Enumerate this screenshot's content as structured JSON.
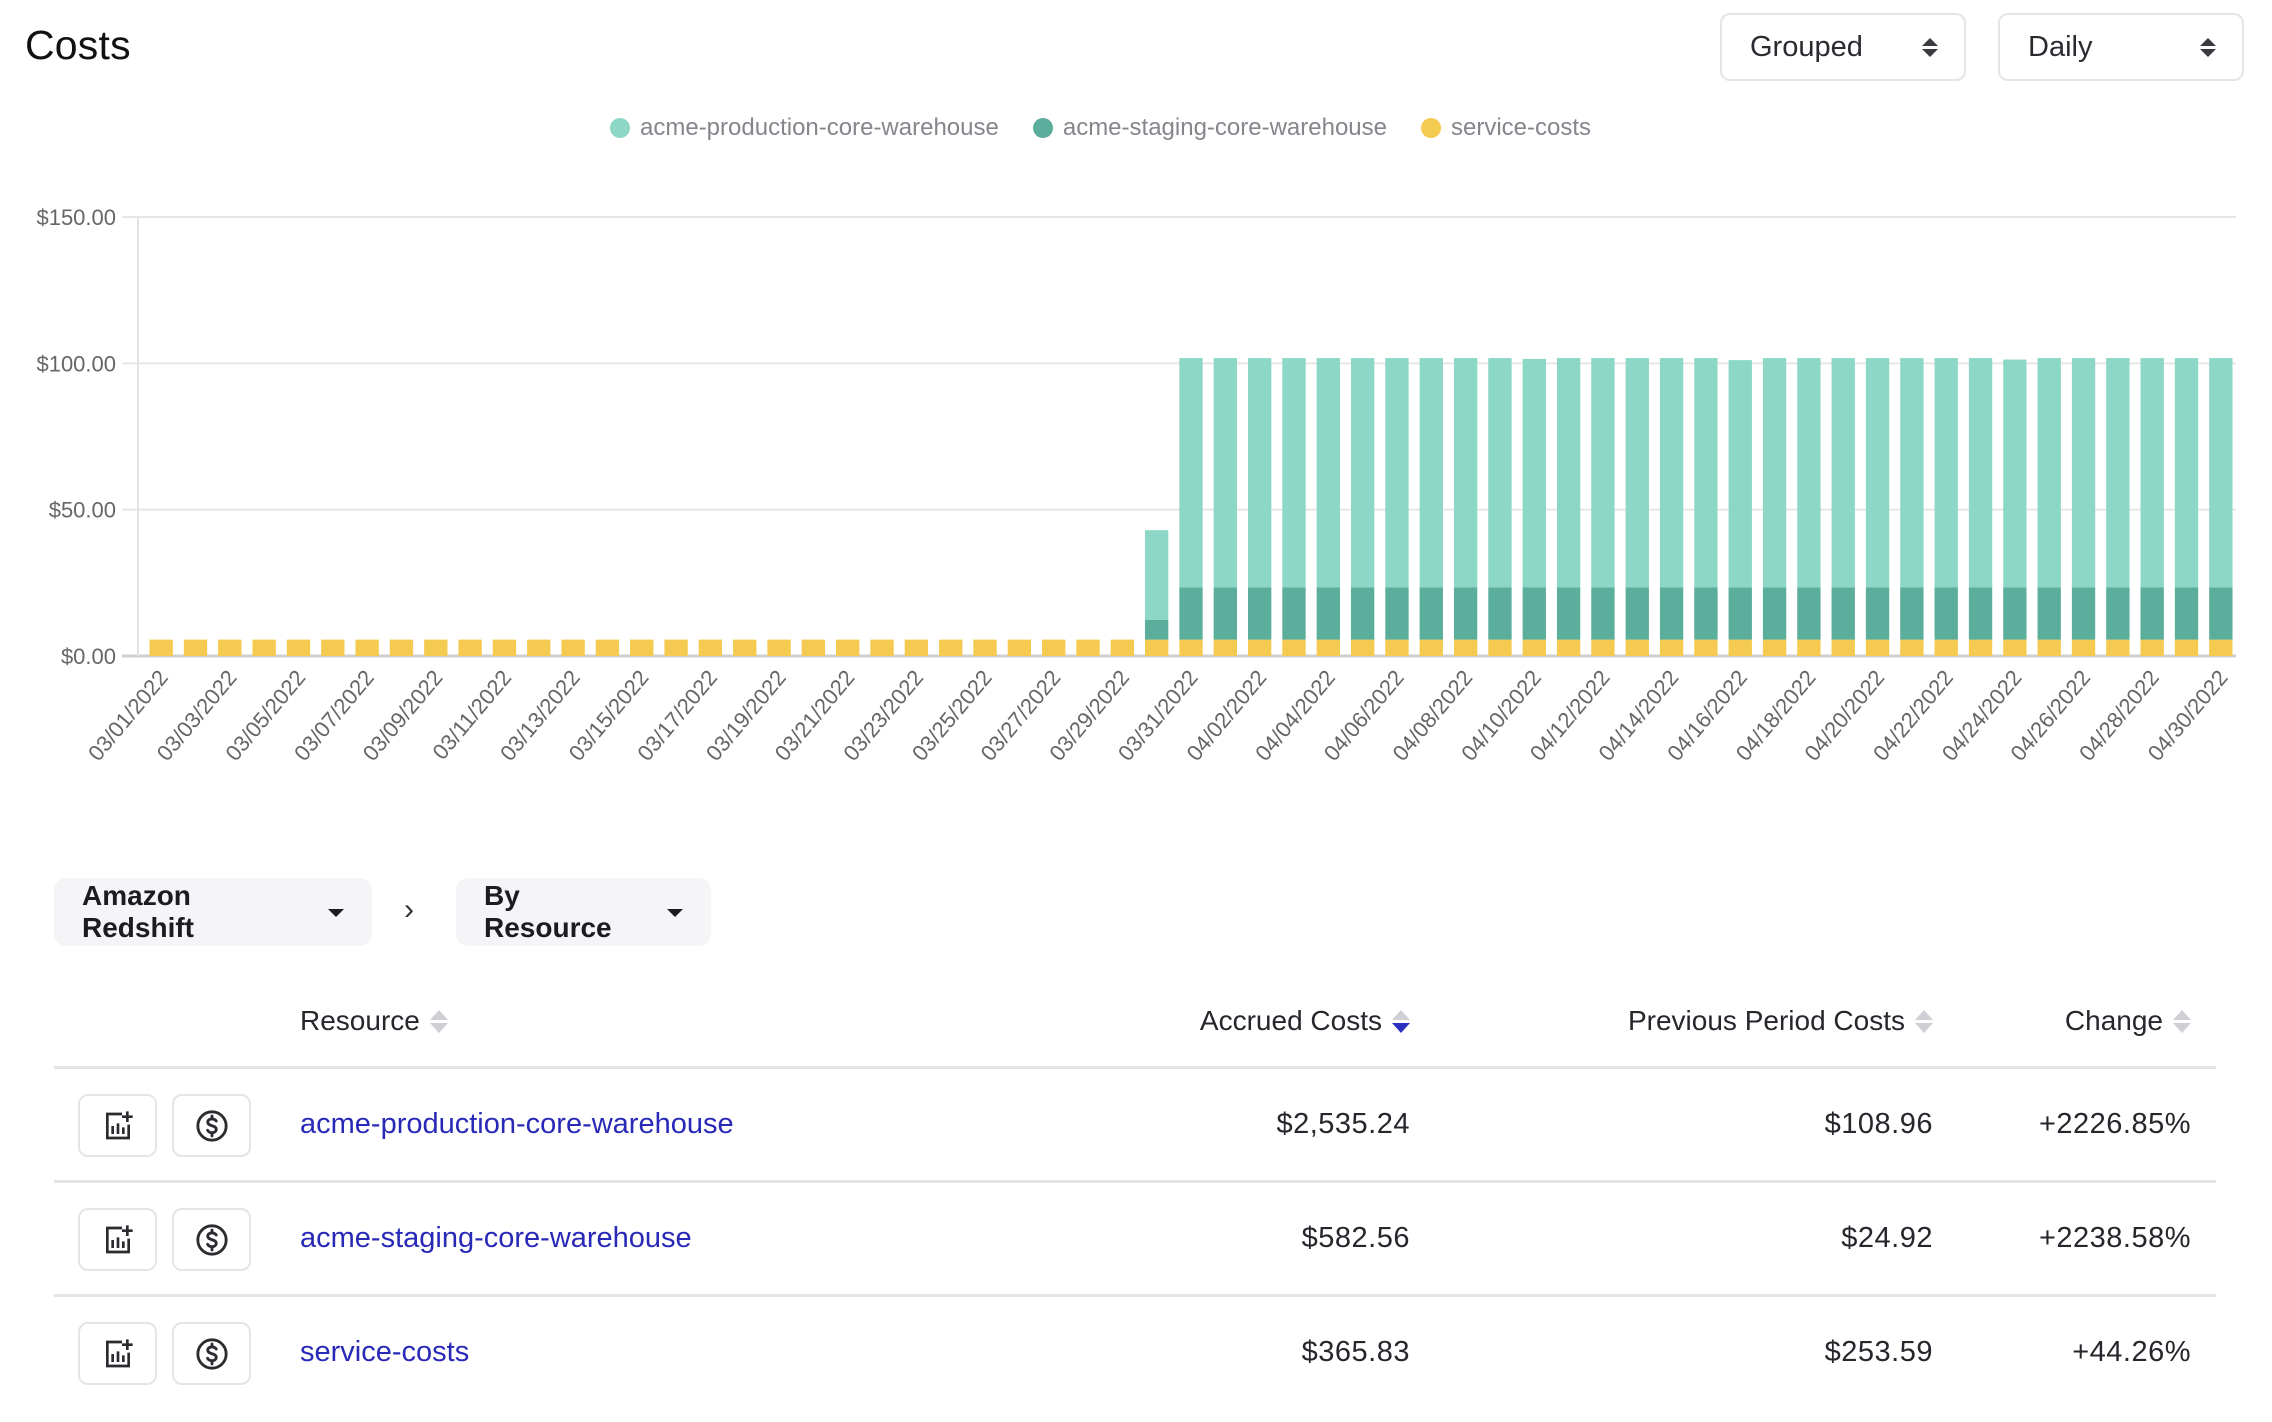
{
  "page": {
    "title": "Costs"
  },
  "controls": {
    "grouping": {
      "selected": "Grouped"
    },
    "granularity": {
      "selected": "Daily"
    }
  },
  "legend": [
    {
      "label": "acme-production-core-warehouse",
      "color": "#8dd7c7"
    },
    {
      "label": "acme-staging-core-warehouse",
      "color": "#5bae9c"
    },
    {
      "label": "service-costs",
      "color": "#f5ca50"
    }
  ],
  "breadcrumb": {
    "service": "Amazon Redshift",
    "separator": "›",
    "grouping": "By Resource"
  },
  "table": {
    "columns": [
      {
        "label": "Resource",
        "sorted": false
      },
      {
        "label": "Accrued Costs",
        "sorted": "desc"
      },
      {
        "label": "Previous Period Costs",
        "sorted": false
      },
      {
        "label": "Change",
        "sorted": false
      }
    ],
    "rows": [
      {
        "resource": "acme-production-core-warehouse",
        "accrued": "$2,535.24",
        "previous": "$108.96",
        "change": "+2226.85%"
      },
      {
        "resource": "acme-staging-core-warehouse",
        "accrued": "$582.56",
        "previous": "$24.92",
        "change": "+2238.58%"
      },
      {
        "resource": "service-costs",
        "accrued": "$365.83",
        "previous": "$253.59",
        "change": "+44.26%"
      }
    ]
  },
  "chart_data": {
    "type": "bar",
    "stacked": true,
    "title": "",
    "xlabel": "",
    "ylabel": "",
    "ylim": [
      0,
      150
    ],
    "yticks": [
      "$0.00",
      "$50.00",
      "$100.00",
      "$150.00"
    ],
    "ytick_values": [
      0,
      50,
      100,
      150
    ],
    "grid": true,
    "legend_position": "top-center",
    "categories": [
      "03/01/2022",
      "03/02/2022",
      "03/03/2022",
      "03/04/2022",
      "03/05/2022",
      "03/06/2022",
      "03/07/2022",
      "03/08/2022",
      "03/09/2022",
      "03/10/2022",
      "03/11/2022",
      "03/12/2022",
      "03/13/2022",
      "03/14/2022",
      "03/15/2022",
      "03/16/2022",
      "03/17/2022",
      "03/18/2022",
      "03/19/2022",
      "03/20/2022",
      "03/21/2022",
      "03/22/2022",
      "03/23/2022",
      "03/24/2022",
      "03/25/2022",
      "03/26/2022",
      "03/27/2022",
      "03/28/2022",
      "03/29/2022",
      "03/30/2022",
      "03/31/2022",
      "04/01/2022",
      "04/02/2022",
      "04/03/2022",
      "04/04/2022",
      "04/05/2022",
      "04/06/2022",
      "04/07/2022",
      "04/08/2022",
      "04/09/2022",
      "04/10/2022",
      "04/11/2022",
      "04/12/2022",
      "04/13/2022",
      "04/14/2022",
      "04/15/2022",
      "04/16/2022",
      "04/17/2022",
      "04/18/2022",
      "04/19/2022",
      "04/20/2022",
      "04/21/2022",
      "04/22/2022",
      "04/23/2022",
      "04/24/2022",
      "04/25/2022",
      "04/26/2022",
      "04/27/2022",
      "04/28/2022",
      "04/29/2022",
      "04/30/2022"
    ],
    "xtick_labels": [
      "03/01/2022",
      "03/03/2022",
      "03/05/2022",
      "03/07/2022",
      "03/09/2022",
      "03/11/2022",
      "03/13/2022",
      "03/15/2022",
      "03/17/2022",
      "03/19/2022",
      "03/21/2022",
      "03/23/2022",
      "03/25/2022",
      "03/27/2022",
      "03/29/2022",
      "03/31/2022",
      "04/02/2022",
      "04/04/2022",
      "04/06/2022",
      "04/08/2022",
      "04/10/2022",
      "04/12/2022",
      "04/14/2022",
      "04/16/2022",
      "04/18/2022",
      "04/20/2022",
      "04/22/2022",
      "04/24/2022",
      "04/26/2022",
      "04/28/2022",
      "04/30/2022"
    ],
    "series": [
      {
        "name": "service-costs",
        "color": "#f5ca50",
        "values": [
          5.6,
          5.6,
          5.6,
          5.6,
          5.6,
          5.6,
          5.6,
          5.6,
          5.6,
          5.6,
          5.6,
          5.6,
          5.6,
          5.6,
          5.6,
          5.6,
          5.6,
          5.6,
          5.6,
          5.6,
          5.6,
          5.6,
          5.6,
          5.6,
          5.6,
          5.6,
          5.6,
          5.6,
          5.6,
          5.6,
          5.6,
          5.6,
          5.6,
          5.6,
          5.6,
          5.6,
          5.6,
          5.6,
          5.6,
          5.6,
          5.6,
          5.6,
          5.6,
          5.6,
          5.6,
          5.6,
          5.6,
          5.6,
          5.6,
          5.6,
          5.6,
          5.6,
          5.6,
          5.6,
          5.6,
          5.6,
          5.6,
          5.6,
          5.6,
          5.6,
          5.6
        ]
      },
      {
        "name": "acme-staging-core-warehouse",
        "color": "#5bae9c",
        "values": [
          0,
          0,
          0,
          0,
          0,
          0,
          0,
          0,
          0,
          0,
          0,
          0,
          0,
          0,
          0,
          0,
          0,
          0,
          0,
          0,
          0,
          0,
          0,
          0,
          0,
          0,
          0,
          0,
          0,
          6.8,
          17.9,
          17.9,
          17.9,
          17.9,
          17.9,
          17.9,
          17.9,
          17.9,
          17.9,
          17.9,
          17.9,
          17.9,
          17.9,
          17.9,
          17.9,
          17.9,
          17.8,
          17.9,
          17.9,
          17.9,
          17.9,
          17.9,
          17.9,
          17.9,
          17.8,
          17.9,
          17.9,
          17.9,
          17.9,
          17.9,
          17.9
        ]
      },
      {
        "name": "acme-production-core-warehouse",
        "color": "#8dd7c7",
        "values": [
          0,
          0,
          0,
          0,
          0,
          0,
          0,
          0,
          0,
          0,
          0,
          0,
          0,
          0,
          0,
          0,
          0,
          0,
          0,
          0,
          0,
          0,
          0,
          0,
          0,
          0,
          0,
          0,
          0,
          30.6,
          78.3,
          78.3,
          78.3,
          78.3,
          78.3,
          78.3,
          78.3,
          78.3,
          78.3,
          78.3,
          78.0,
          78.3,
          78.3,
          78.3,
          78.3,
          78.3,
          77.7,
          78.3,
          78.3,
          78.3,
          78.3,
          78.3,
          78.3,
          78.3,
          77.9,
          78.3,
          78.3,
          78.3,
          78.3,
          78.3,
          78.3
        ]
      }
    ]
  }
}
